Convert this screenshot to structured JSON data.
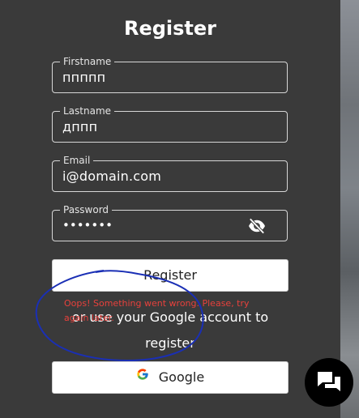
{
  "page": {
    "title": "Register"
  },
  "form": {
    "firstname": {
      "label": "Firstname",
      "value": "ппппп"
    },
    "lastname": {
      "label": "Lastname",
      "value": "дппп"
    },
    "email": {
      "label": "Email",
      "value": "i@domain.com"
    },
    "password": {
      "label": "Password",
      "value": "•••••••"
    }
  },
  "actions": {
    "register_label": "Register",
    "google_label": "Google"
  },
  "error": {
    "message": "Oops! Something went wrong. Please, try again later."
  },
  "alt_text": "or use your Google account to register",
  "icons": {
    "password_toggle": "eye-off-icon",
    "google": "google-logo-icon",
    "chat": "chat-icon"
  },
  "colors": {
    "panel_bg": "#3a3a3a",
    "error": "#e8413c",
    "annotation": "#1a2fb5"
  }
}
